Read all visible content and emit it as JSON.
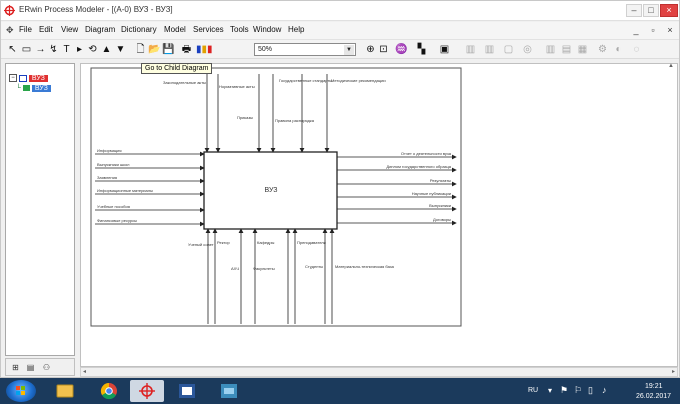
{
  "window": {
    "title": "ERwin Process Modeler - [(A-0) ВУЗ - ВУЗ]",
    "buttons": {
      "minimize": "–",
      "maximize": "□",
      "close": "×"
    }
  },
  "menu": {
    "items": [
      "File",
      "Edit",
      "View",
      "Diagram",
      "Dictionary",
      "Model",
      "Services",
      "Tools",
      "Window",
      "Help"
    ],
    "mdi_minimize": "_",
    "mdi_restore": "▫",
    "mdi_close": "×"
  },
  "toolbar": {
    "zoom_value": "50%",
    "tooltip": "Go to Child Diagram"
  },
  "model_tree": {
    "root_label": "ВУЗ",
    "child_label": "ВУЗ"
  },
  "diagram": {
    "activity_label": "ВУЗ",
    "inputs": [
      "Информация",
      "Выпускники школ",
      "Заявления",
      "Информационные материалы",
      "Учебные пособия",
      "Финансовые ресурсы"
    ],
    "outputs": [
      "Отчет о деятельности вуза",
      "Диплом государственного образца",
      "Результаты",
      "Научные публикации",
      "Выпускники",
      "Договоры"
    ],
    "controls": [
      "Законодательные акты",
      "Нормативные акты",
      "Государственные стандарты",
      "Методические рекомендации",
      "Приказы",
      "Правила распорядка"
    ],
    "mechanisms": [
      "Ученый совет",
      "Ректор",
      "АХЧ",
      "Кафедры",
      "Факультеты",
      "Преподаватели",
      "Студенты",
      "Материально-техническая база"
    ]
  },
  "taskbar": {
    "language": "RU",
    "time": "19:21",
    "date": "26.02.2017"
  },
  "colors": {
    "accent_red": "#e03030",
    "selection_blue": "#3a7bd5",
    "taskbar": "#1b3a5c"
  }
}
